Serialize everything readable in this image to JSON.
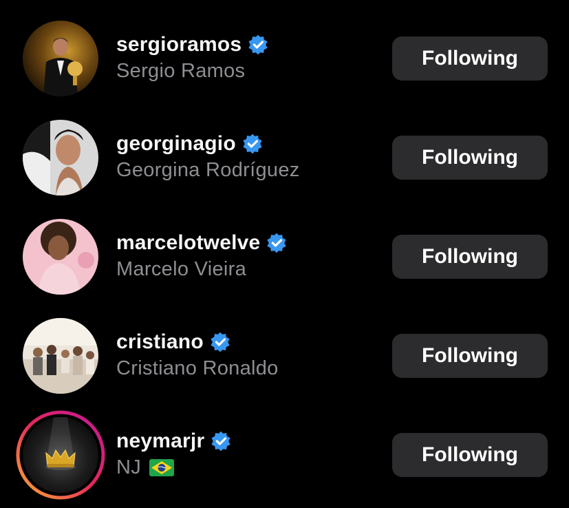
{
  "accent_color": "#3897f0",
  "button_color": "#2c2c2e",
  "accounts": [
    {
      "username": "sergioramos",
      "full_name": "Sergio Ramos",
      "verified": true,
      "button_label": "Following",
      "avatar_icon": "sergio-ramos-trophy-photo",
      "has_story": false
    },
    {
      "username": "georginagio",
      "full_name": "Georgina Rodríguez",
      "verified": true,
      "button_label": "Following",
      "avatar_icon": "georgina-portrait-photo",
      "has_story": false
    },
    {
      "username": "marcelotwelve",
      "full_name": "Marcelo Vieira",
      "verified": true,
      "button_label": "Following",
      "avatar_icon": "marcelo-pink-portrait-photo",
      "has_story": false
    },
    {
      "username": "cristiano",
      "full_name": "Cristiano Ronaldo",
      "verified": true,
      "button_label": "Following",
      "avatar_icon": "cristiano-family-photo",
      "has_story": false
    },
    {
      "username": "neymarjr",
      "full_name": "NJ",
      "verified": true,
      "button_label": "Following",
      "avatar_icon": "crown-spotlight-image",
      "has_story": true,
      "flag_icon": "brazil-flag-icon"
    }
  ]
}
